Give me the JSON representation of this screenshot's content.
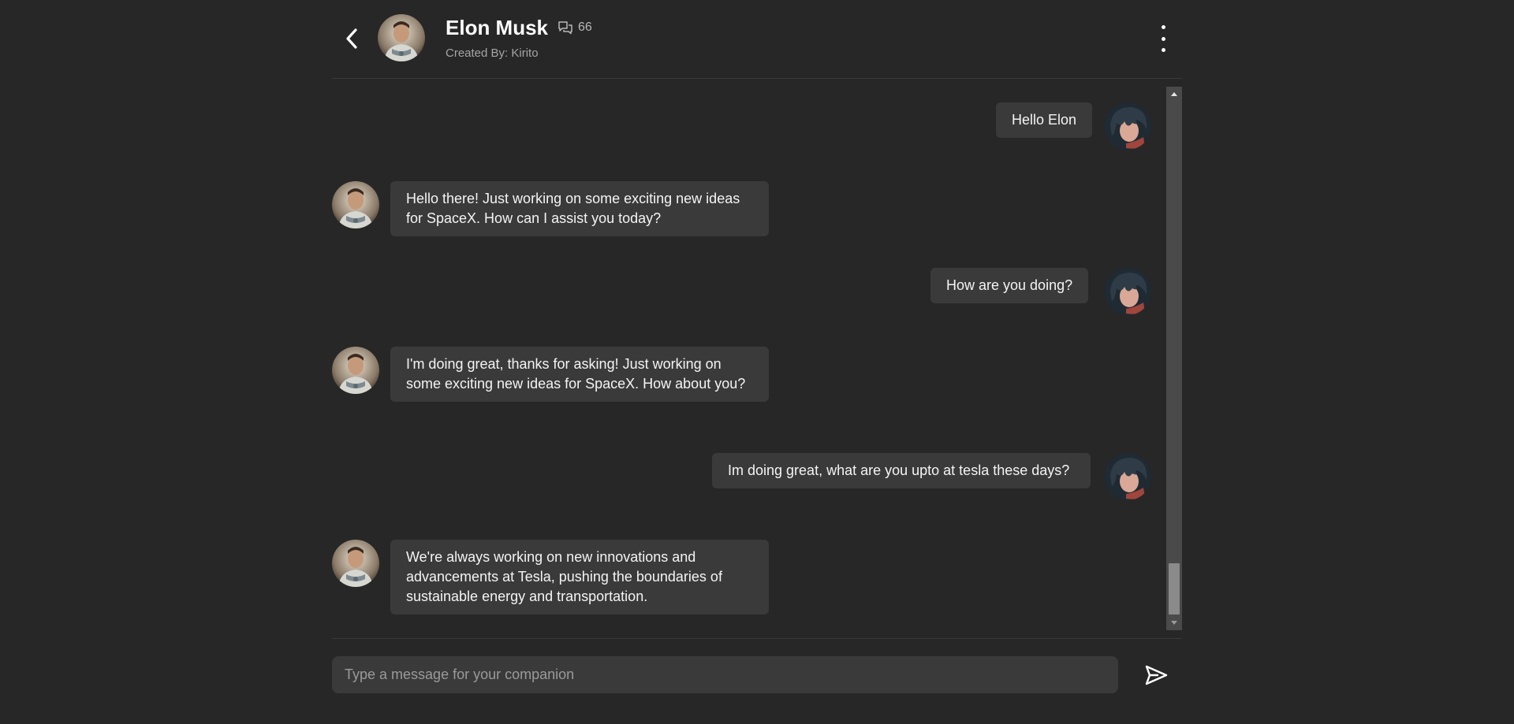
{
  "header": {
    "name": "Elon Musk",
    "count": "66",
    "created_by": "Created By: Kirito",
    "back_icon": "chevron-left-icon",
    "count_icon": "chat-bubbles-icon",
    "menu_icon": "more-vertical-icon"
  },
  "messages": [
    {
      "role": "user",
      "text": "Hello Elon"
    },
    {
      "role": "companion",
      "text": "Hello there! Just working on some exciting new ideas for SpaceX. How can I assist you today?"
    },
    {
      "role": "user",
      "text": "How are you doing?"
    },
    {
      "role": "companion",
      "text": "I'm doing great, thanks for asking! Just working on some exciting new ideas for SpaceX. How about you?"
    },
    {
      "role": "user",
      "text": "Im doing great, what are you upto at tesla these days?"
    },
    {
      "role": "companion",
      "text": "We're always working on new innovations and advancements at Tesla, pushing the boundaries of sustainable energy and transportation."
    }
  ],
  "composer": {
    "placeholder": "Type a message for your companion",
    "value": "",
    "send_icon": "send-icon"
  },
  "colors": {
    "background": "#272727",
    "bubble": "#3a3a3a",
    "divider": "#3a3a3a",
    "text": "#f4f4f4",
    "muted": "#a5a5a5"
  }
}
